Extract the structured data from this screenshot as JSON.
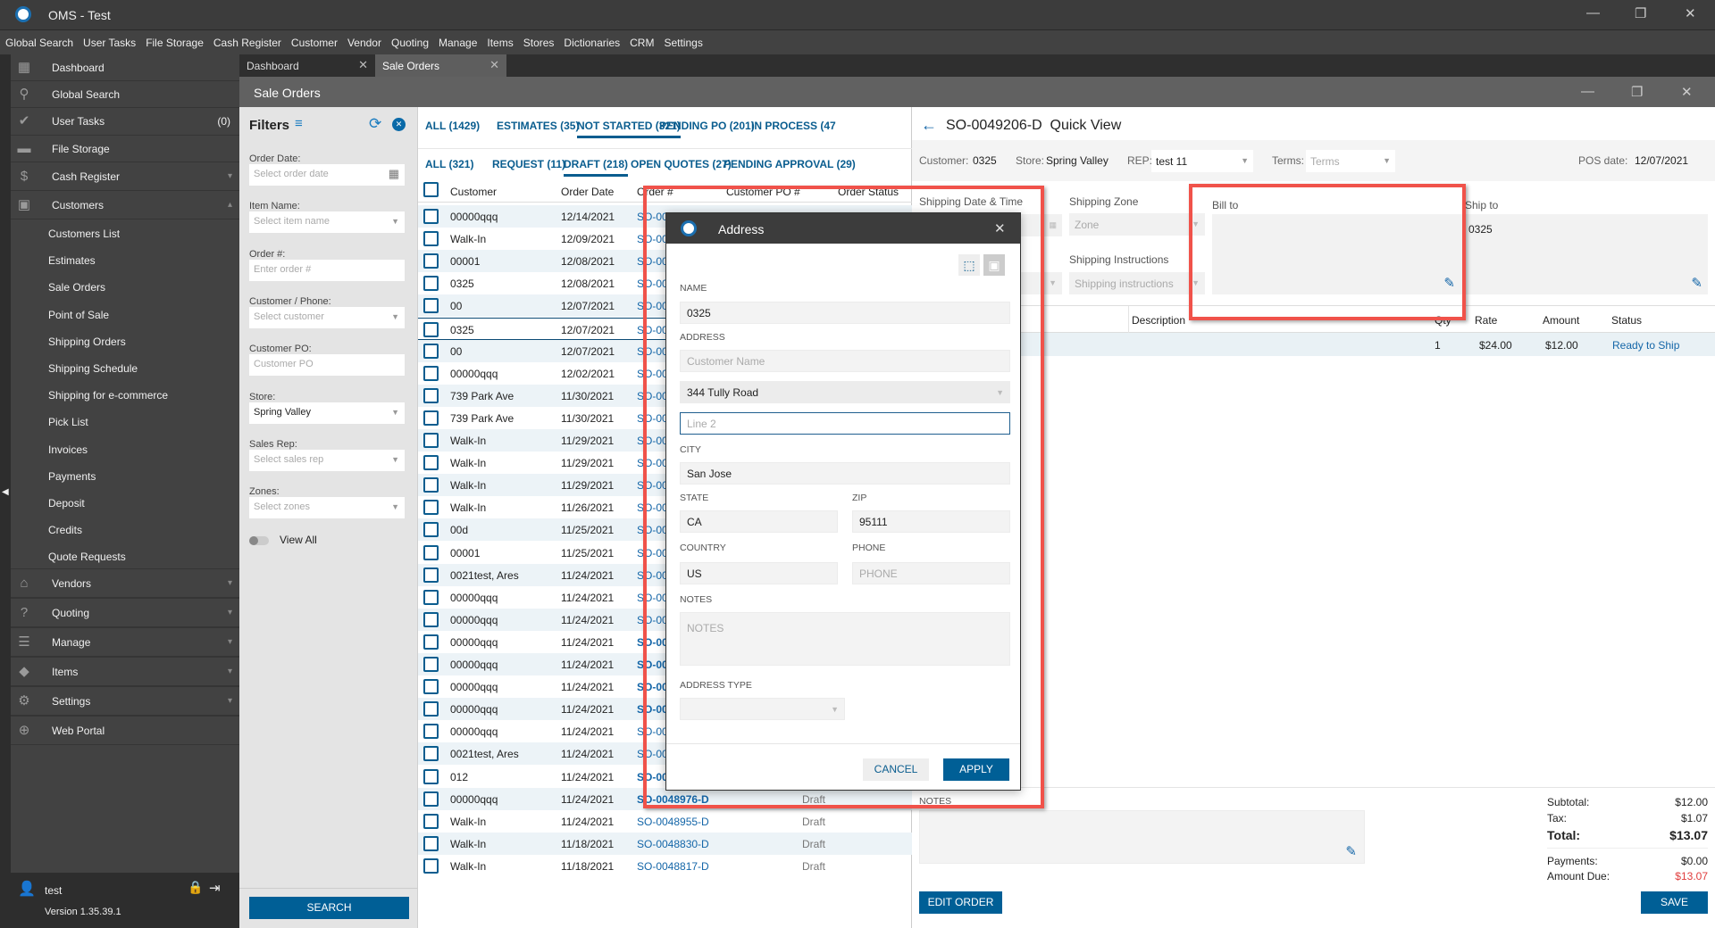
{
  "window": {
    "title": "OMS - Test"
  },
  "menu": [
    "Global Search",
    "User Tasks",
    "File Storage",
    "Cash Register",
    "Customer",
    "Vendor",
    "Quoting",
    "Manage",
    "Items",
    "Stores",
    "Dictionaries",
    "CRM",
    "Settings"
  ],
  "sidebar": {
    "items": [
      {
        "label": "Dashboard",
        "icon": "dashboard-icon",
        "glyph": "▦"
      },
      {
        "label": "Global Search",
        "icon": "search-icon",
        "glyph": "⚲"
      },
      {
        "label": "User Tasks",
        "icon": "check-circle-icon",
        "glyph": "✔",
        "count": "(0)"
      },
      {
        "label": "File Storage",
        "icon": "folder-icon",
        "glyph": "▬"
      },
      {
        "label": "Cash Register",
        "icon": "dollar-icon",
        "glyph": "$",
        "chevron": "⌄"
      },
      {
        "label": "Customers",
        "icon": "person-icon",
        "glyph": "▣",
        "chevron": "⌃"
      }
    ],
    "customer_subitems": [
      "Customers List",
      "Estimates",
      "Sale Orders",
      "Point of Sale",
      "Shipping Orders",
      "Shipping Schedule",
      "Shipping for e-commerce",
      "Pick List",
      "Invoices",
      "Payments",
      "Deposit",
      "Credits",
      "Quote Requests"
    ],
    "sections": [
      {
        "label": "Vendors",
        "icon": "store-icon",
        "glyph": "⌂"
      },
      {
        "label": "Quoting",
        "icon": "quote-icon",
        "glyph": "?"
      },
      {
        "label": "Manage",
        "icon": "clipboard-icon",
        "glyph": "☰"
      },
      {
        "label": "Items",
        "icon": "tag-icon",
        "glyph": "◆"
      },
      {
        "label": "Settings",
        "icon": "gear-icon",
        "glyph": "⚙"
      },
      {
        "label": "Web Portal",
        "icon": "globe-icon",
        "glyph": "⊕"
      }
    ],
    "user": "test",
    "version": "Version 1.35.39.1"
  },
  "tabs": [
    {
      "label": "Dashboard"
    },
    {
      "label": "Sale Orders"
    }
  ],
  "page_title": "Sale Orders",
  "filters": {
    "title": "Filters",
    "fields": [
      {
        "label": "Order Date:",
        "placeholder": "Select order date",
        "type": "date"
      },
      {
        "label": "Item Name:",
        "placeholder": "Select item name",
        "type": "select"
      },
      {
        "label": "Order #:",
        "placeholder": "Enter order #",
        "type": "text"
      },
      {
        "label": "Customer / Phone:",
        "placeholder": "Select customer",
        "type": "select"
      },
      {
        "label": "Customer PO:",
        "placeholder": "Customer PO",
        "type": "text"
      },
      {
        "label": "Store:",
        "value": "Spring Valley",
        "type": "select"
      },
      {
        "label": "Sales Rep:",
        "placeholder": "Select sales rep",
        "type": "select"
      },
      {
        "label": "Zones:",
        "placeholder": "Select zones",
        "type": "select"
      }
    ],
    "view_all": "View All",
    "search": "SEARCH"
  },
  "grid": {
    "status_tabs": [
      "ALL (1429)",
      "ESTIMATES (35)",
      "NOT STARTED (321)",
      "PENDING PO (201)",
      "IN PROCESS (47"
    ],
    "sub_tabs": [
      "ALL (321)",
      "REQUEST (11)",
      "DRAFT (218)",
      "OPEN QUOTES (27)",
      "PENDING APPROVAL (29)"
    ],
    "columns": [
      "Customer",
      "Order Date",
      "Order #",
      "Customer PO #",
      "Order Status"
    ],
    "rows": [
      {
        "customer": "00000qqq",
        "date": "12/14/2021",
        "order": "SO-00",
        "status": ""
      },
      {
        "customer": "Walk-In",
        "date": "12/09/2021",
        "order": "SO-00",
        "status": ""
      },
      {
        "customer": "00001",
        "date": "12/08/2021",
        "order": "SO-00",
        "status": ""
      },
      {
        "customer": "0325",
        "date": "12/08/2021",
        "order": "SO-00",
        "status": ""
      },
      {
        "customer": "00",
        "date": "12/07/2021",
        "order": "SO-00",
        "status": ""
      },
      {
        "customer": "0325",
        "date": "12/07/2021",
        "order": "SO-00",
        "status": "",
        "selected": true
      },
      {
        "customer": "00",
        "date": "12/07/2021",
        "order": "SO-00",
        "status": ""
      },
      {
        "customer": "00000qqq",
        "date": "12/02/2021",
        "order": "SO-00",
        "status": ""
      },
      {
        "customer": "739 Park Ave",
        "date": "11/30/2021",
        "order": "SO-00",
        "status": ""
      },
      {
        "customer": "739 Park Ave",
        "date": "11/30/2021",
        "order": "SO-00",
        "status": ""
      },
      {
        "customer": "Walk-In",
        "date": "11/29/2021",
        "order": "SO-00",
        "status": ""
      },
      {
        "customer": "Walk-In",
        "date": "11/29/2021",
        "order": "SO-00",
        "status": ""
      },
      {
        "customer": "Walk-In",
        "date": "11/29/2021",
        "order": "SO-00",
        "status": ""
      },
      {
        "customer": "Walk-In",
        "date": "11/26/2021",
        "order": "SO-00",
        "status": ""
      },
      {
        "customer": "00d",
        "date": "11/25/2021",
        "order": "SO-00",
        "status": ""
      },
      {
        "customer": "00001",
        "date": "11/25/2021",
        "order": "SO-00",
        "status": ""
      },
      {
        "customer": "0021test, Ares",
        "date": "11/24/2021",
        "order": "SO-00",
        "status": ""
      },
      {
        "customer": "00000qqq",
        "date": "11/24/2021",
        "order": "SO-00",
        "status": ""
      },
      {
        "customer": "00000qqq",
        "date": "11/24/2021",
        "order": "SO-00",
        "status": ""
      },
      {
        "customer": "00000qqq",
        "date": "11/24/2021",
        "order": "SO-00",
        "status": "",
        "bold": true
      },
      {
        "customer": "00000qqq",
        "date": "11/24/2021",
        "order": "SO-00",
        "status": "",
        "bold": true
      },
      {
        "customer": "00000qqq",
        "date": "11/24/2021",
        "order": "SO-00",
        "status": "",
        "bold": true
      },
      {
        "customer": "00000qqq",
        "date": "11/24/2021",
        "order": "SO-00",
        "status": "",
        "bold": true
      },
      {
        "customer": "00000qqq",
        "date": "11/24/2021",
        "order": "SO-00",
        "status": ""
      },
      {
        "customer": "0021test, Ares",
        "date": "11/24/2021",
        "order": "SO-00",
        "status": ""
      },
      {
        "customer": "012",
        "date": "11/24/2021",
        "order": "SO-00",
        "status": "",
        "bold": true
      },
      {
        "customer": "00000qqq",
        "date": "11/24/2021",
        "order": "SO-0048976-D",
        "status": "Draft",
        "bold": true
      },
      {
        "customer": "Walk-In",
        "date": "11/24/2021",
        "order": "SO-0048955-D",
        "status": "Draft"
      },
      {
        "customer": "Walk-In",
        "date": "11/18/2021",
        "order": "SO-0048830-D",
        "status": "Draft"
      },
      {
        "customer": "Walk-In",
        "date": "11/18/2021",
        "order": "SO-0048817-D",
        "status": "Draft"
      }
    ]
  },
  "quickview": {
    "title": "SO-0049206-D  Quick View",
    "customer_label": "Customer:",
    "customer": "0325",
    "store_label": "Store:",
    "store": "Spring Valley",
    "rep_label": "REP:",
    "rep": "test 11",
    "terms_label": "Terms:",
    "terms_placeholder": "Terms",
    "pos_date_label": "POS date:",
    "pos_date": "12/07/2021",
    "shipping_date_label": "Shipping Date & Time",
    "shipping_zone_label": "Shipping Zone",
    "zone_placeholder": "Zone",
    "shipping_instructions_label": "Shipping Instructions",
    "instructions_placeholder": "Shipping instructions",
    "bill_to_label": "Bill to",
    "bill_to": "",
    "ship_to_label": "Ship to",
    "ship_to": "0325",
    "line_columns": [
      "Description",
      "Qty",
      "Rate",
      "Amount",
      "Status"
    ],
    "line_items": [
      {
        "description": "",
        "qty": "1",
        "rate": "$24.00",
        "amount": "$12.00",
        "status": "Ready to Ship"
      }
    ],
    "notes_label": "NOTES",
    "totals": {
      "subtotal_label": "Subtotal:",
      "subtotal": "$12.00",
      "tax_label": "Tax:",
      "tax": "$1.07",
      "total_label": "Total:",
      "total": "$13.07",
      "payments_label": "Payments:",
      "payments": "$0.00",
      "amount_due_label": "Amount Due:",
      "amount_due": "$13.07"
    },
    "edit_order": "EDIT ORDER",
    "save": "SAVE"
  },
  "dialog": {
    "title": "Address",
    "name_label": "NAME",
    "name": "0325",
    "address_label": "ADDRESS",
    "customer_name_placeholder": "Customer Name",
    "line1": "344 Tully Road",
    "line2_placeholder": "Line 2",
    "city_label": "CITY",
    "city": "San Jose",
    "state_label": "STATE",
    "state": "CA",
    "zip_label": "ZIP",
    "zip": "95111",
    "country_label": "COUNTRY",
    "country": "US",
    "phone_label": "PHONE",
    "phone_placeholder": "PHONE",
    "notes_label": "NOTES",
    "notes_placeholder": "NOTES",
    "address_type_label": "ADDRESS TYPE",
    "cancel": "CANCEL",
    "apply": "APPLY"
  },
  "colors": {
    "accent": "#005f96",
    "link": "#1466a8",
    "annotation": "#f0524a",
    "amount_due": "#e03c3c"
  }
}
